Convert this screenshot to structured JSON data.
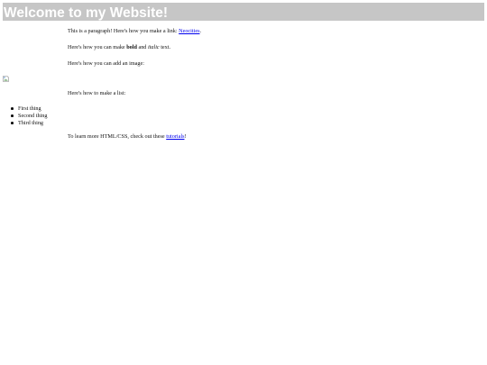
{
  "header": {
    "title": "Welcome to my Website!"
  },
  "paragraph1": {
    "text_before": "This is a paragraph! Here's how you make a link: ",
    "link_text": "Neocities",
    "text_after": "."
  },
  "paragraph2": {
    "prefix": "Here's how you can make ",
    "bold": "bold",
    "middle": " and ",
    "italic": "italic",
    "suffix": " text."
  },
  "paragraph3": {
    "text": "Here's how you can add an image:"
  },
  "image": {
    "icon": "broken-image-icon"
  },
  "paragraph4": {
    "text": "Here's how to make a list:"
  },
  "list": {
    "items": [
      "First thing",
      "Second thing",
      "Third thing"
    ]
  },
  "paragraph5": {
    "text_before": "To learn more HTML/CSS, check out these ",
    "link_text": "tutorials",
    "text_after": "!"
  }
}
